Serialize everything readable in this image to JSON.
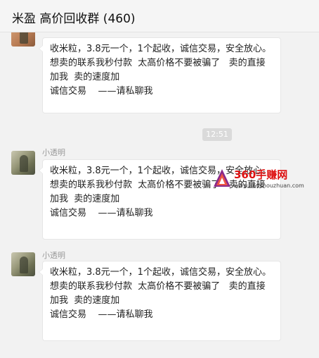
{
  "header": {
    "title": "米盈 高价回收群 (460)"
  },
  "messages": [
    {
      "sender": "",
      "lines": [
        "收米粒，3.8元一个，1个起收，诚信交易，安全放心。",
        "想卖的联系我秒付款  太高价格不要被骗了   卖的直接加我  卖的速度加",
        "诚信交易    ——请私聊我"
      ]
    },
    {
      "sender": "小透明",
      "lines": [
        "收米粒，3.8元一个，1个起收，诚信交易，安全放心。",
        "想卖的联系我秒付款  太高价格不要被骗了   卖的直接加我  卖的速度加",
        "诚信交易    ——请私聊我"
      ]
    },
    {
      "sender": "小透明",
      "lines": [
        "收米粒，3.8元一个，1个起收，诚信交易，安全放心。",
        "想卖的联系我秒付款  太高价格不要被骗了   卖的直接加我  卖的速度加",
        "诚信交易    ——请私聊我"
      ]
    }
  ],
  "timestamp": "12:51",
  "watermark": {
    "name": "360手赚网",
    "url": "www.360shouzhuan.com"
  }
}
